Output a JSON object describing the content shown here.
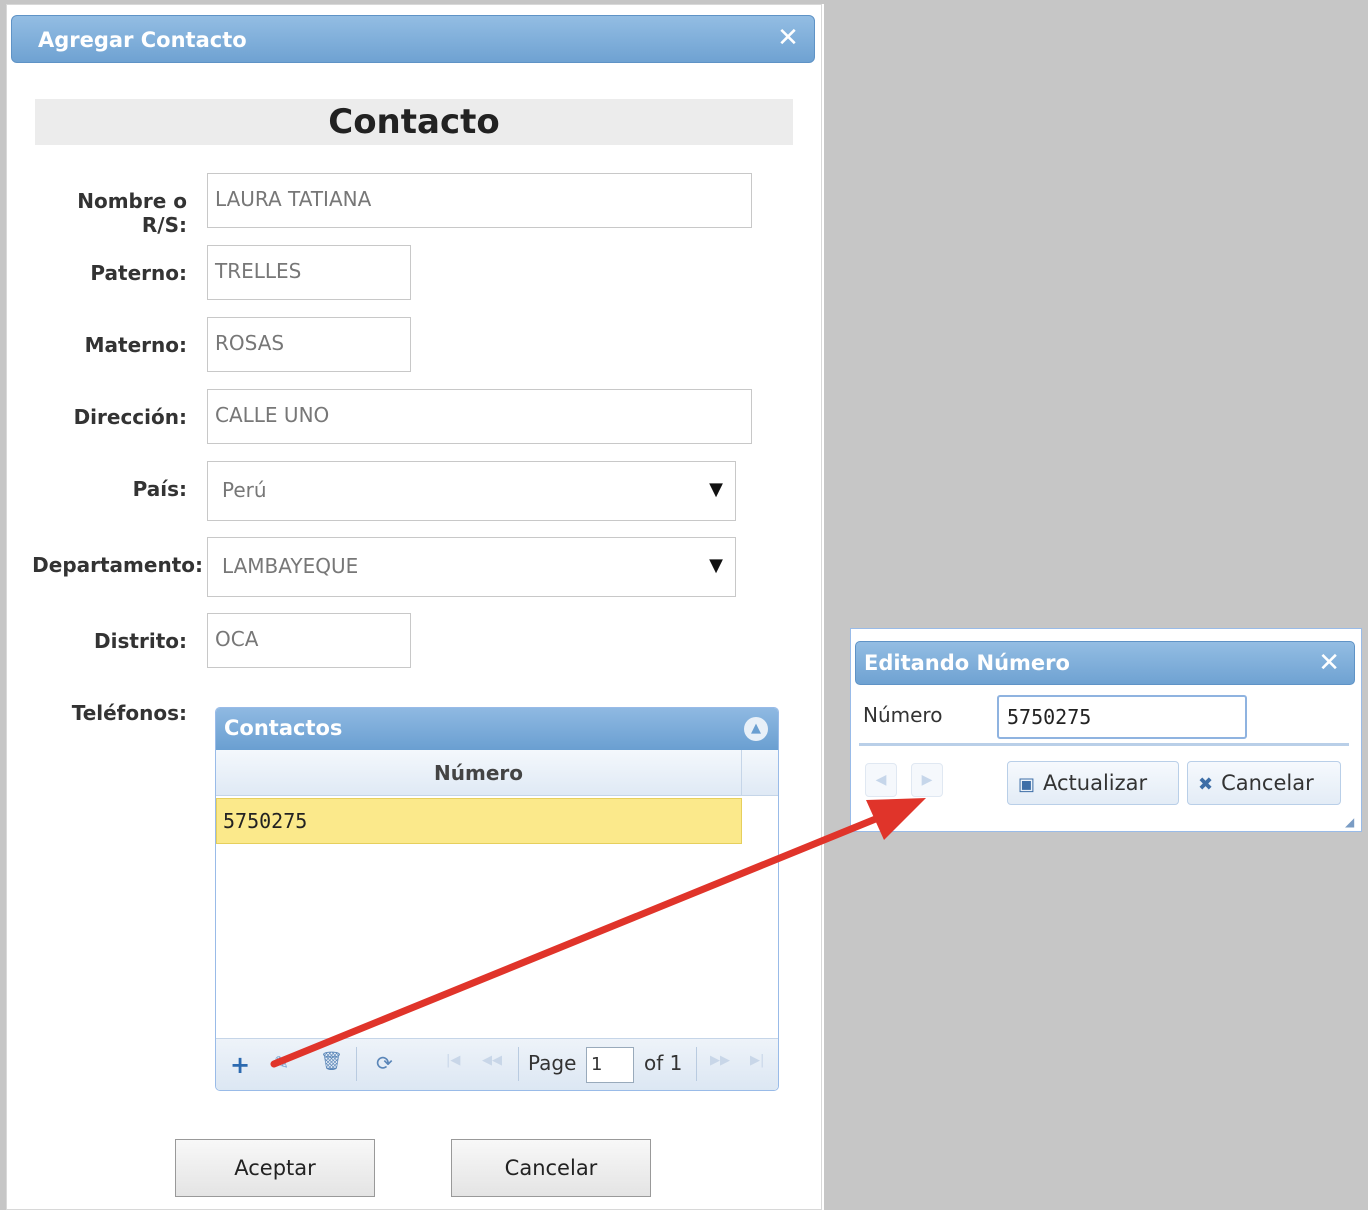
{
  "main_dialog": {
    "title": "Agregar Contacto",
    "close_icon": "close-icon",
    "section_title": "Contacto",
    "fields": {
      "nombre_label_line1": "Nombre o",
      "nombre_label_line2": "R/S:",
      "nombre_value": "LAURA TATIANA",
      "paterno_label": "Paterno:",
      "paterno_value": "TRELLES",
      "materno_label": "Materno:",
      "materno_value": "ROSAS",
      "direccion_label": "Dirección:",
      "direccion_value": "CALLE UNO",
      "pais_label": "País:",
      "pais_value": "Perú",
      "departamento_label": "Departamento:",
      "departamento_value": "LAMBAYEQUE",
      "distrito_label": "Distrito:",
      "distrito_value": "OCA",
      "telefonos_label": "Teléfonos:"
    },
    "grid": {
      "title": "Contactos",
      "column_header": "Número",
      "rows": [
        "5750275"
      ],
      "toolbar": {
        "page_label": "Page",
        "page_value": "1",
        "of_label": "of 1"
      }
    },
    "buttons": {
      "accept": "Aceptar",
      "cancel": "Cancelar"
    }
  },
  "edit_dialog": {
    "title": "Editando Número",
    "field_label": "Número",
    "field_value": "5750275",
    "update_button": "Actualizar",
    "cancel_button": "Cancelar"
  },
  "colors": {
    "header_blue": "#6fa2d2",
    "selected_row": "#fbe98b",
    "arrow_red": "#e0342a"
  }
}
